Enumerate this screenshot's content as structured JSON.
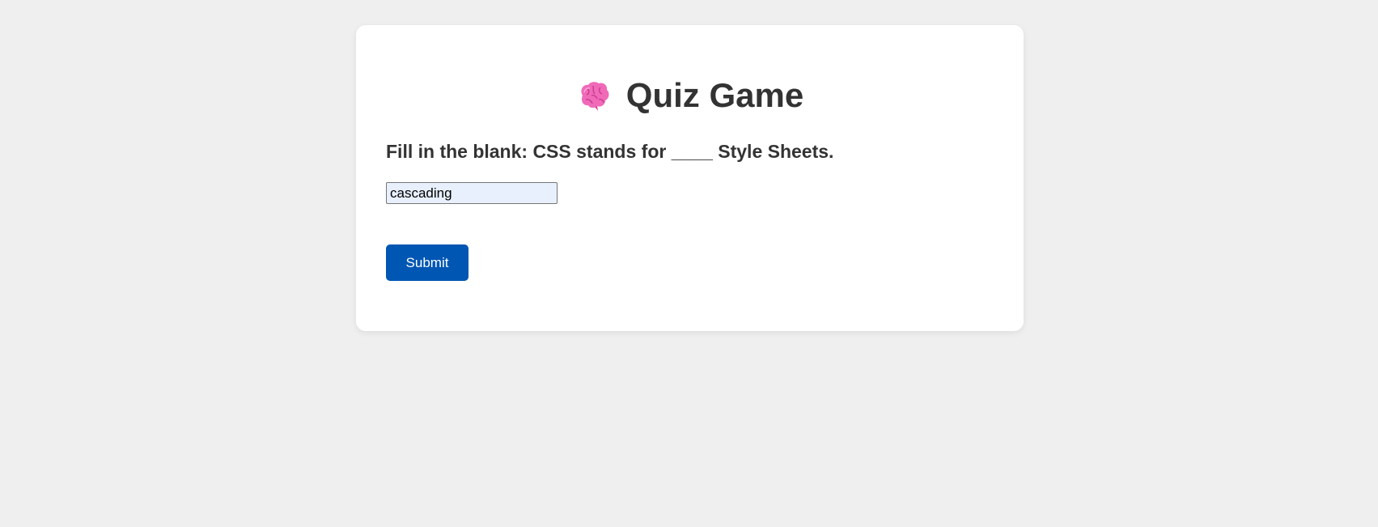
{
  "header": {
    "icon": "brain-icon",
    "title": "Quiz Game"
  },
  "quiz": {
    "question": "Fill in the blank: CSS stands for ____ Style Sheets.",
    "answer_value": "cascading"
  },
  "actions": {
    "submit_label": "Submit"
  },
  "colors": {
    "background": "#efefef",
    "card": "#ffffff",
    "text": "#333333",
    "button": "#0056b3",
    "input_background": "#e8f0fe"
  }
}
